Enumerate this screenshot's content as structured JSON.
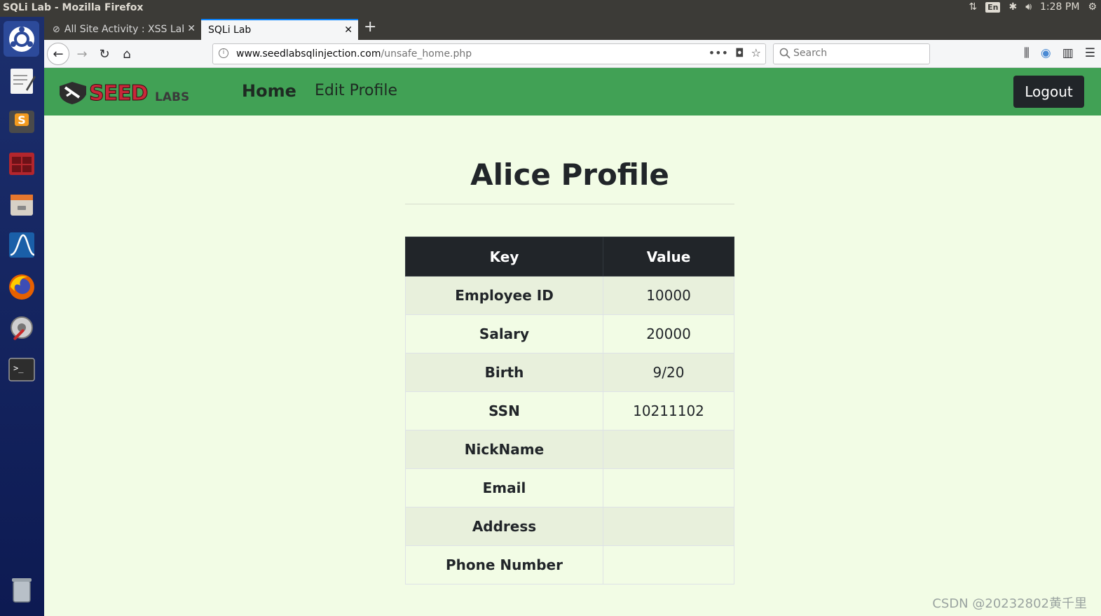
{
  "os": {
    "window_title": "SQLi Lab - Mozilla Firefox",
    "lang_indicator": "En",
    "clock": "1:28 PM"
  },
  "browser": {
    "tabs": [
      {
        "label": "All Site Activity : XSS Lab",
        "active": false
      },
      {
        "label": "SQLi Lab",
        "active": true
      }
    ],
    "url_host": "www.seedlabsqlinjection.com",
    "url_path": "/unsafe_home.php",
    "search_placeholder": "Search"
  },
  "site": {
    "logo_text": "SEEDLABS",
    "nav": {
      "home": "Home",
      "edit_profile": "Edit Profile"
    },
    "logout": "Logout",
    "accent_color": "#41a155"
  },
  "profile": {
    "title": "Alice Profile",
    "headers": {
      "key": "Key",
      "value": "Value"
    },
    "rows": [
      {
        "key": "Employee ID",
        "value": "10000"
      },
      {
        "key": "Salary",
        "value": "20000"
      },
      {
        "key": "Birth",
        "value": "9/20"
      },
      {
        "key": "SSN",
        "value": "10211102"
      },
      {
        "key": "NickName",
        "value": ""
      },
      {
        "key": "Email",
        "value": ""
      },
      {
        "key": "Address",
        "value": ""
      },
      {
        "key": "Phone Number",
        "value": ""
      }
    ]
  },
  "watermark": "CSDN @20232802黄千里"
}
